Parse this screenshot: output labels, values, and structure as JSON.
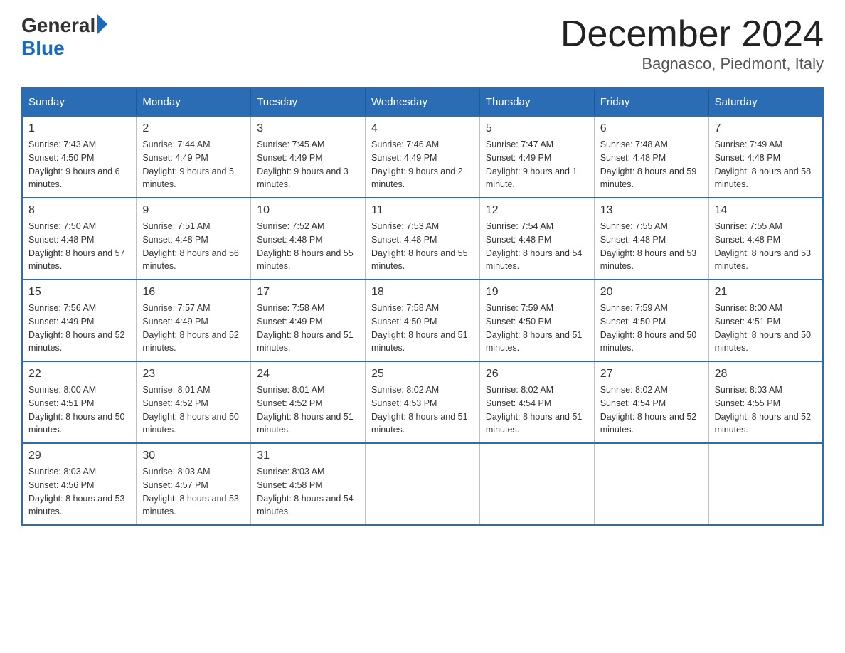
{
  "header": {
    "logo_general": "General",
    "logo_blue": "Blue",
    "title": "December 2024",
    "subtitle": "Bagnasco, Piedmont, Italy"
  },
  "days_of_week": [
    "Sunday",
    "Monday",
    "Tuesday",
    "Wednesday",
    "Thursday",
    "Friday",
    "Saturday"
  ],
  "weeks": [
    [
      {
        "day": "1",
        "sunrise": "7:43 AM",
        "sunset": "4:50 PM",
        "daylight": "9 hours and 6 minutes."
      },
      {
        "day": "2",
        "sunrise": "7:44 AM",
        "sunset": "4:49 PM",
        "daylight": "9 hours and 5 minutes."
      },
      {
        "day": "3",
        "sunrise": "7:45 AM",
        "sunset": "4:49 PM",
        "daylight": "9 hours and 3 minutes."
      },
      {
        "day": "4",
        "sunrise": "7:46 AM",
        "sunset": "4:49 PM",
        "daylight": "9 hours and 2 minutes."
      },
      {
        "day": "5",
        "sunrise": "7:47 AM",
        "sunset": "4:49 PM",
        "daylight": "9 hours and 1 minute."
      },
      {
        "day": "6",
        "sunrise": "7:48 AM",
        "sunset": "4:48 PM",
        "daylight": "8 hours and 59 minutes."
      },
      {
        "day": "7",
        "sunrise": "7:49 AM",
        "sunset": "4:48 PM",
        "daylight": "8 hours and 58 minutes."
      }
    ],
    [
      {
        "day": "8",
        "sunrise": "7:50 AM",
        "sunset": "4:48 PM",
        "daylight": "8 hours and 57 minutes."
      },
      {
        "day": "9",
        "sunrise": "7:51 AM",
        "sunset": "4:48 PM",
        "daylight": "8 hours and 56 minutes."
      },
      {
        "day": "10",
        "sunrise": "7:52 AM",
        "sunset": "4:48 PM",
        "daylight": "8 hours and 55 minutes."
      },
      {
        "day": "11",
        "sunrise": "7:53 AM",
        "sunset": "4:48 PM",
        "daylight": "8 hours and 55 minutes."
      },
      {
        "day": "12",
        "sunrise": "7:54 AM",
        "sunset": "4:48 PM",
        "daylight": "8 hours and 54 minutes."
      },
      {
        "day": "13",
        "sunrise": "7:55 AM",
        "sunset": "4:48 PM",
        "daylight": "8 hours and 53 minutes."
      },
      {
        "day": "14",
        "sunrise": "7:55 AM",
        "sunset": "4:48 PM",
        "daylight": "8 hours and 53 minutes."
      }
    ],
    [
      {
        "day": "15",
        "sunrise": "7:56 AM",
        "sunset": "4:49 PM",
        "daylight": "8 hours and 52 minutes."
      },
      {
        "day": "16",
        "sunrise": "7:57 AM",
        "sunset": "4:49 PM",
        "daylight": "8 hours and 52 minutes."
      },
      {
        "day": "17",
        "sunrise": "7:58 AM",
        "sunset": "4:49 PM",
        "daylight": "8 hours and 51 minutes."
      },
      {
        "day": "18",
        "sunrise": "7:58 AM",
        "sunset": "4:50 PM",
        "daylight": "8 hours and 51 minutes."
      },
      {
        "day": "19",
        "sunrise": "7:59 AM",
        "sunset": "4:50 PM",
        "daylight": "8 hours and 51 minutes."
      },
      {
        "day": "20",
        "sunrise": "7:59 AM",
        "sunset": "4:50 PM",
        "daylight": "8 hours and 50 minutes."
      },
      {
        "day": "21",
        "sunrise": "8:00 AM",
        "sunset": "4:51 PM",
        "daylight": "8 hours and 50 minutes."
      }
    ],
    [
      {
        "day": "22",
        "sunrise": "8:00 AM",
        "sunset": "4:51 PM",
        "daylight": "8 hours and 50 minutes."
      },
      {
        "day": "23",
        "sunrise": "8:01 AM",
        "sunset": "4:52 PM",
        "daylight": "8 hours and 50 minutes."
      },
      {
        "day": "24",
        "sunrise": "8:01 AM",
        "sunset": "4:52 PM",
        "daylight": "8 hours and 51 minutes."
      },
      {
        "day": "25",
        "sunrise": "8:02 AM",
        "sunset": "4:53 PM",
        "daylight": "8 hours and 51 minutes."
      },
      {
        "day": "26",
        "sunrise": "8:02 AM",
        "sunset": "4:54 PM",
        "daylight": "8 hours and 51 minutes."
      },
      {
        "day": "27",
        "sunrise": "8:02 AM",
        "sunset": "4:54 PM",
        "daylight": "8 hours and 52 minutes."
      },
      {
        "day": "28",
        "sunrise": "8:03 AM",
        "sunset": "4:55 PM",
        "daylight": "8 hours and 52 minutes."
      }
    ],
    [
      {
        "day": "29",
        "sunrise": "8:03 AM",
        "sunset": "4:56 PM",
        "daylight": "8 hours and 53 minutes."
      },
      {
        "day": "30",
        "sunrise": "8:03 AM",
        "sunset": "4:57 PM",
        "daylight": "8 hours and 53 minutes."
      },
      {
        "day": "31",
        "sunrise": "8:03 AM",
        "sunset": "4:58 PM",
        "daylight": "8 hours and 54 minutes."
      },
      null,
      null,
      null,
      null
    ]
  ]
}
